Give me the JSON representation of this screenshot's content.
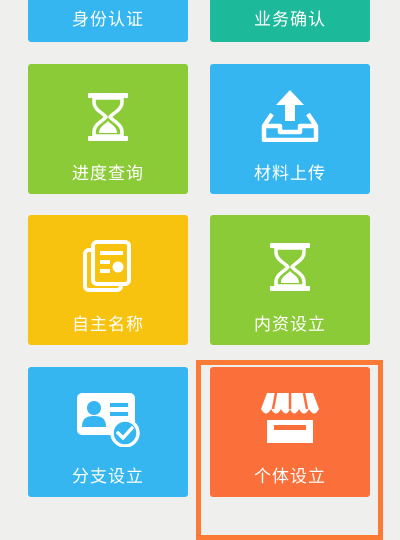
{
  "tiles": [
    {
      "label": "身份认证",
      "icon": "id-card-icon",
      "color": "#35b6f0"
    },
    {
      "label": "业务确认",
      "icon": "confirm-icon",
      "color": "#1cb99a"
    },
    {
      "label": "进度查询",
      "icon": "hourglass-icon",
      "color": "#8ccb38"
    },
    {
      "label": "材料上传",
      "icon": "upload-tray-icon",
      "color": "#35b6f0"
    },
    {
      "label": "自主名称",
      "icon": "document-list-icon",
      "color": "#f8c30f"
    },
    {
      "label": "内资设立",
      "icon": "hourglass-icon",
      "color": "#8ccb38"
    },
    {
      "label": "分支设立",
      "icon": "id-card-check-icon",
      "color": "#35b6f0"
    },
    {
      "label": "个体设立",
      "icon": "storefront-icon",
      "color": "#fa6f3a"
    }
  ],
  "highlight": {
    "target": "个体设立",
    "color": "#fb7b36"
  }
}
